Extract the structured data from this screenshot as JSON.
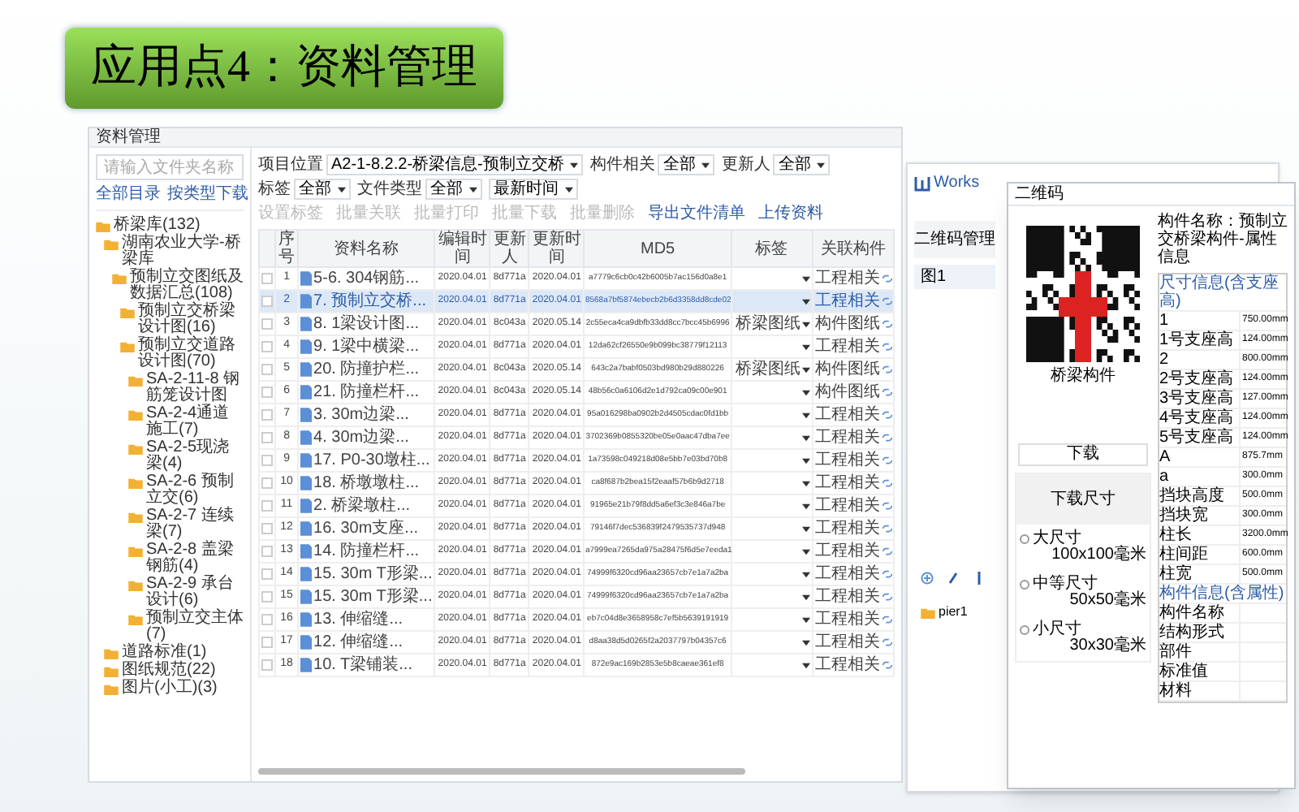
{
  "slide_title": "应用点4：资料管理",
  "file_window": {
    "title": "资料管理",
    "search": {
      "placeholder": "请输入文件夹名称"
    },
    "sidebar_buttons": [
      "全部目录",
      "按类型下载"
    ],
    "tree": [
      {
        "label": "桥梁库(132)",
        "children": [
          {
            "label": "湖南农业大学-桥梁库",
            "children": [
              {
                "label": "预制立交图纸及数据汇总(108)",
                "children": [
                  {
                    "label": "预制立交桥梁设计图(16)"
                  },
                  {
                    "label": "预制立交道路设计图(70)",
                    "children": [
                      {
                        "label": "SA-2-11-8 钢筋笼设计图"
                      },
                      {
                        "label": "SA-2-4通道施工(7)"
                      },
                      {
                        "label": "SA-2-5现浇梁(4)"
                      },
                      {
                        "label": "SA-2-6 预制立交(6)"
                      },
                      {
                        "label": "SA-2-7 连续梁(7)"
                      },
                      {
                        "label": "SA-2-8 盖梁钢筋(4)"
                      },
                      {
                        "label": "SA-2-9 承台设计(6)"
                      },
                      {
                        "label": "预制立交主体(7)"
                      }
                    ]
                  }
                ]
              }
            ]
          },
          {
            "label": "道路标准(1)"
          },
          {
            "label": "图纸规范(22)"
          },
          {
            "label": "图片(小工)(3)"
          }
        ]
      }
    ],
    "filters": [
      {
        "label": "项目位置",
        "value": "A2-1-8.2.2-桥梁信息-预制立交桥"
      },
      {
        "label": "构件相关",
        "value": "全部"
      },
      {
        "label": "更新人",
        "value": "全部"
      },
      {
        "label": "标签",
        "value": "全部"
      },
      {
        "label": "文件类型",
        "value": "全部"
      },
      {
        "label": "最新时间"
      }
    ],
    "actions": [
      {
        "label": "设置标签",
        "disabled": true
      },
      {
        "label": "批量关联",
        "disabled": true
      },
      {
        "label": "批量打印",
        "disabled": true
      },
      {
        "label": "批量下载",
        "disabled": true
      },
      {
        "label": "批量删除",
        "disabled": true
      },
      {
        "label": "导出文件清单",
        "disabled": false
      },
      {
        "label": "上传资料",
        "disabled": false
      }
    ],
    "columns": [
      "序号",
      "资料名称",
      "编辑时间",
      "更新人",
      "更新时间",
      "MD5",
      "标签",
      "关联构件"
    ],
    "rows": [
      {
        "no": "1",
        "name": "5-6. 304钢筋...",
        "edited": "2020.04.01",
        "user": "8d771a",
        "updated": "2020.04.01",
        "md5": "a7779c6cb0c42b6005b7ac156d0a8e1",
        "link": "工程相关",
        "selected": false
      },
      {
        "no": "2",
        "name": "7. 预制立交桥...",
        "edited": "2020.04.01",
        "user": "8d771a",
        "updated": "2020.04.01",
        "md5": "8568a7bf5874ebecb2b6d3358dd8cde02",
        "link": "工程相关",
        "selected": true
      },
      {
        "no": "3",
        "name": "8. 1梁设计图...",
        "edited": "2020.04.01",
        "user": "8c043a",
        "updated": "2020.05.14",
        "md5": "2c55eca4ca9dbfb33dd8cc7bcc45b6996",
        "tag": "桥梁图纸",
        "link": "构件图纸",
        "selected": false
      },
      {
        "no": "4",
        "name": "9. 1梁中横梁...",
        "edited": "2020.04.01",
        "user": "8d771a",
        "updated": "2020.04.01",
        "md5": "12da62cf26550e9b099bc38779f12113",
        "link": "工程相关",
        "selected": false
      },
      {
        "no": "5",
        "name": "20. 防撞护栏...",
        "edited": "2020.04.01",
        "user": "8c043a",
        "updated": "2020.05.14",
        "md5": "643c2a7babf0503bd980b29d880226",
        "tag": "桥梁图纸",
        "link": "构件图纸",
        "selected": false
      },
      {
        "no": "6",
        "name": "21. 防撞栏杆...",
        "edited": "2020.04.01",
        "user": "8c043a",
        "updated": "2020.05.14",
        "md5": "48b56c0a6106d2e1d792ca09c00e901",
        "link": "构件图纸",
        "selected": false
      },
      {
        "no": "7",
        "name": "3. 30m边梁...",
        "edited": "2020.04.01",
        "user": "8d771a",
        "updated": "2020.04.01",
        "md5": "95a016298ba0902b2d4505cdac0fd1bb",
        "link": "工程相关",
        "selected": false
      },
      {
        "no": "8",
        "name": "4. 30m边梁...",
        "edited": "2020.04.01",
        "user": "8d771a",
        "updated": "2020.04.01",
        "md5": "3702369b0855320be05e0aac47dba7ee",
        "link": "工程相关",
        "selected": false
      },
      {
        "no": "9",
        "name": "17. P0-30墩柱...",
        "edited": "2020.04.01",
        "user": "8d771a",
        "updated": "2020.04.01",
        "md5": "1a73598c049218d08e5bb7e03bd70b8",
        "link": "工程相关",
        "selected": false
      },
      {
        "no": "10",
        "name": "18. 桥墩墩柱...",
        "edited": "2020.04.01",
        "user": "8d771a",
        "updated": "2020.04.01",
        "md5": "ca8f687b2bea15f2eaaf57b6b9d2718",
        "link": "工程相关",
        "selected": false
      },
      {
        "no": "11",
        "name": "2. 桥梁墩柱...",
        "edited": "2020.04.01",
        "user": "8d771a",
        "updated": "2020.04.01",
        "md5": "91965e21b79f8dd5a6ef3c3e846a7be",
        "link": "工程相关",
        "selected": false
      },
      {
        "no": "12",
        "name": "16. 30m支座...",
        "edited": "2020.04.01",
        "user": "8d771a",
        "updated": "2020.04.01",
        "md5": "79146f7dec536839f2479535737d948",
        "link": "工程相关",
        "selected": false
      },
      {
        "no": "13",
        "name": "14. 防撞栏杆...",
        "edited": "2020.04.01",
        "user": "8d771a",
        "updated": "2020.04.01",
        "md5": "a7999ea7265da975a28475f6d5e7eeda1",
        "link": "工程相关",
        "selected": false
      },
      {
        "no": "14",
        "name": "15. 30m T形梁...",
        "edited": "2020.04.01",
        "user": "8d771a",
        "updated": "2020.04.01",
        "md5": "74999f6320cd96aa23657cb7e1a7a2ba",
        "link": "工程相关",
        "selected": false
      },
      {
        "no": "15",
        "name": "15. 30m T形梁...",
        "edited": "2020.04.01",
        "user": "8d771a",
        "updated": "2020.04.01",
        "md5": "74999f6320cd96aa23657cb7e1a7a2ba",
        "link": "工程相关",
        "selected": false
      },
      {
        "no": "16",
        "name": "13. 伸缩缝...",
        "edited": "2020.04.01",
        "user": "8d771a",
        "updated": "2020.04.01",
        "md5": "eb7c04d8e3658958c7ef5b5639191919",
        "link": "工程相关",
        "selected": false
      },
      {
        "no": "17",
        "name": "12. 伸缩缝...",
        "edited": "2020.04.01",
        "user": "8d771a",
        "updated": "2020.04.01",
        "md5": "d8aa38d5d0265f2a2037797b04357c6",
        "link": "工程相关",
        "selected": false
      },
      {
        "no": "18",
        "name": "10. T梁铺装...",
        "edited": "2020.04.01",
        "user": "8d771a",
        "updated": "2020.04.01",
        "md5": "872e9ac169b2853e5b8caeae361ef8",
        "link": "工程相关",
        "selected": false
      }
    ]
  },
  "works_window": {
    "logo": "Works",
    "tab": "二维码管理",
    "list_item": "图1",
    "tree_item": "pier1"
  },
  "qr_dialog": {
    "title": "二维码",
    "caption": "桥梁构件",
    "download_button": "下载",
    "size_panel_title": "下载尺寸",
    "sizes": [
      {
        "label": "大尺寸",
        "value": "100x100毫米",
        "selected": false
      },
      {
        "label": "中等尺寸",
        "value": "50x50毫米",
        "selected": false
      },
      {
        "label": "小尺寸",
        "value": "30x30毫米",
        "selected": false
      }
    ],
    "heading": "构件名称：预制立交桥梁构件-属性信息",
    "properties": [
      {
        "kind": "section",
        "label": "尺寸信息(含支座高)"
      },
      {
        "kind": "row",
        "label": "1",
        "value": "750.00mm"
      },
      {
        "kind": "row",
        "label": "1号支座高",
        "value": "124.00mm"
      },
      {
        "kind": "row",
        "label": "2",
        "value": "800.00mm"
      },
      {
        "kind": "row",
        "label": "2号支座高",
        "value": "124.00mm"
      },
      {
        "kind": "row",
        "label": "3号支座高",
        "value": "127.00mm"
      },
      {
        "kind": "row",
        "label": "4号支座高",
        "value": "124.00mm"
      },
      {
        "kind": "row",
        "label": "5号支座高",
        "value": "124.00mm"
      },
      {
        "kind": "row",
        "label": "A",
        "value": "875.7mm"
      },
      {
        "kind": "row",
        "label": "a",
        "value": "300.0mm"
      },
      {
        "kind": "row",
        "label": "挡块高度",
        "value": "500.0mm"
      },
      {
        "kind": "row",
        "label": "挡块宽",
        "value": "300.0mm"
      },
      {
        "kind": "row",
        "label": "柱长",
        "value": "3200.0mm"
      },
      {
        "kind": "row",
        "label": "柱间距",
        "value": "600.0mm"
      },
      {
        "kind": "row",
        "label": "柱宽",
        "value": "500.0mm"
      },
      {
        "kind": "section",
        "label": "构件信息(含属性)"
      },
      {
        "kind": "row",
        "label": "构件名称"
      },
      {
        "kind": "row",
        "label": "结构形式"
      },
      {
        "kind": "row",
        "label": "部件"
      },
      {
        "kind": "row",
        "label": "标准值"
      },
      {
        "kind": "row",
        "label": "材料"
      }
    ]
  }
}
